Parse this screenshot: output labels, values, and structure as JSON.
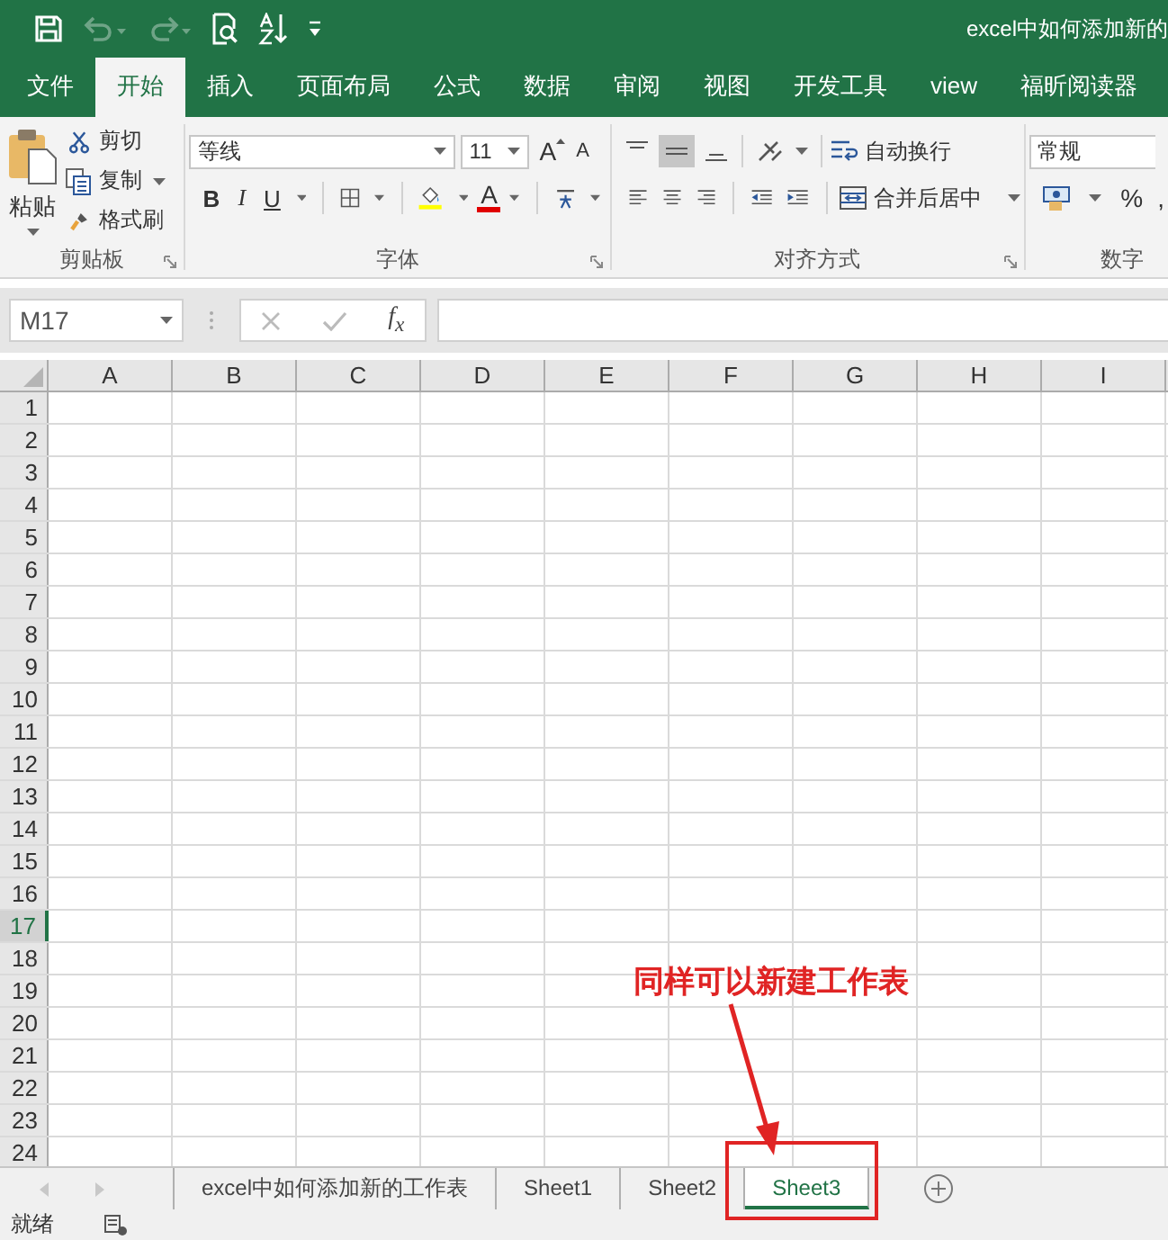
{
  "title_bar": {
    "title": "excel中如何添加新的"
  },
  "quick_access": [
    {
      "kind": "save",
      "disabled": false
    },
    {
      "kind": "undo",
      "disabled": true
    },
    {
      "kind": "redo",
      "disabled": true
    },
    {
      "kind": "print-preview",
      "disabled": false
    },
    {
      "kind": "sort",
      "disabled": false
    },
    {
      "kind": "customize",
      "disabled": false
    }
  ],
  "ribbon_tabs": [
    {
      "label": "文件",
      "selected": false
    },
    {
      "label": "开始",
      "selected": true
    },
    {
      "label": "插入",
      "selected": false
    },
    {
      "label": "页面布局",
      "selected": false
    },
    {
      "label": "公式",
      "selected": false
    },
    {
      "label": "数据",
      "selected": false
    },
    {
      "label": "审阅",
      "selected": false
    },
    {
      "label": "视图",
      "selected": false
    },
    {
      "label": "开发工具",
      "selected": false
    },
    {
      "label": "view",
      "selected": false
    },
    {
      "label": "福昕阅读器",
      "selected": false
    }
  ],
  "clipboard": {
    "paste": "粘贴",
    "actions": [
      {
        "kind": "cut",
        "label": "剪切"
      },
      {
        "kind": "copy",
        "label": "复制"
      },
      {
        "kind": "format-painter",
        "label": "格式刷"
      }
    ],
    "group_label": "剪贴板"
  },
  "font": {
    "font_name": "等线",
    "font_size": "11",
    "grow": "A",
    "shrink": "A",
    "bold": "B",
    "italic": "I",
    "underline": "U",
    "font_color": "A",
    "group_label": "字体"
  },
  "alignment": {
    "vertical": [
      {
        "kind": "top",
        "selected": false
      },
      {
        "kind": "middle",
        "selected": true
      },
      {
        "kind": "bottom",
        "selected": false
      }
    ],
    "wrap_text": "自动换行",
    "merge_center": "合并后居中",
    "group_label": "对齐方式"
  },
  "number": {
    "format": "常规",
    "percent": "%",
    "comma": ",",
    "group_label": "数字"
  },
  "formula_bar": {
    "name_box": "M17",
    "function_label": "f$_{x}$"
  },
  "sheet": {
    "columns": [
      "A",
      "B",
      "C",
      "D",
      "E",
      "F",
      "G",
      "H",
      "I"
    ],
    "rows": [
      {
        "label": "1",
        "selected": false
      },
      {
        "label": "2",
        "selected": false
      },
      {
        "label": "3",
        "selected": false
      },
      {
        "label": "4",
        "selected": false
      },
      {
        "label": "5",
        "selected": false
      },
      {
        "label": "6",
        "selected": false
      },
      {
        "label": "7",
        "selected": false
      },
      {
        "label": "8",
        "selected": false
      },
      {
        "label": "9",
        "selected": false
      },
      {
        "label": "10",
        "selected": false
      },
      {
        "label": "11",
        "selected": false
      },
      {
        "label": "12",
        "selected": false
      },
      {
        "label": "13",
        "selected": false
      },
      {
        "label": "14",
        "selected": false
      },
      {
        "label": "15",
        "selected": false
      },
      {
        "label": "16",
        "selected": false
      },
      {
        "label": "17",
        "selected": true
      },
      {
        "label": "18",
        "selected": false
      },
      {
        "label": "19",
        "selected": false
      },
      {
        "label": "20",
        "selected": false
      },
      {
        "label": "21",
        "selected": false
      },
      {
        "label": "22",
        "selected": false
      },
      {
        "label": "23",
        "selected": false
      },
      {
        "label": "24",
        "selected": false
      }
    ]
  },
  "sheet_tabs": [
    {
      "label": "excel中如何添加新的工作表",
      "selected": false
    },
    {
      "label": "Sheet1",
      "selected": false
    },
    {
      "label": "Sheet2",
      "selected": false
    },
    {
      "label": "Sheet3",
      "selected": true
    }
  ],
  "status_bar": {
    "status": "就绪"
  },
  "annotation": {
    "text": "同样可以新建工作表"
  }
}
